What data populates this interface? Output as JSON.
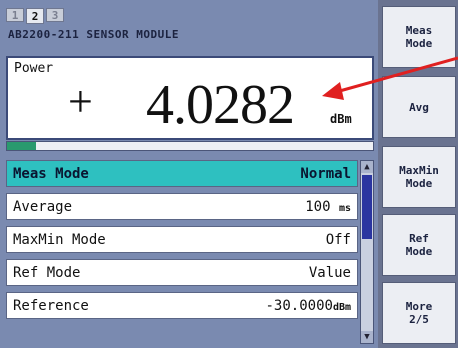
{
  "tabs": [
    "1",
    "2",
    "3"
  ],
  "active_tab": "2",
  "module_title": "AB2200-211 SENSOR MODULE",
  "power": {
    "label": "Power",
    "sign": "+",
    "value": "4.0282",
    "unit": "dBm"
  },
  "level_bar": {
    "fraction": 0.08,
    "color": "#2a9a6e"
  },
  "params": [
    {
      "label": "Meas Mode",
      "value": "Normal",
      "unit": "",
      "selected": true
    },
    {
      "label": "Average",
      "value": "100",
      "unit": "ms",
      "selected": false
    },
    {
      "label": "MaxMin Mode",
      "value": "Off",
      "unit": "",
      "selected": false
    },
    {
      "label": "Ref Mode",
      "value": "Value",
      "unit": "",
      "selected": false
    },
    {
      "label": "Reference",
      "value": "-30.0000",
      "unit": "dBm",
      "selected": false
    }
  ],
  "softkeys": [
    "Meas\nMode",
    "Avg",
    "MaxMin\nMode",
    "Ref\nMode",
    "More\n2/5"
  ],
  "colors": {
    "selected_row": "#2ec0c0",
    "annotation_arrow": "#e02020",
    "scroll_thumb": "#2a35a0"
  }
}
